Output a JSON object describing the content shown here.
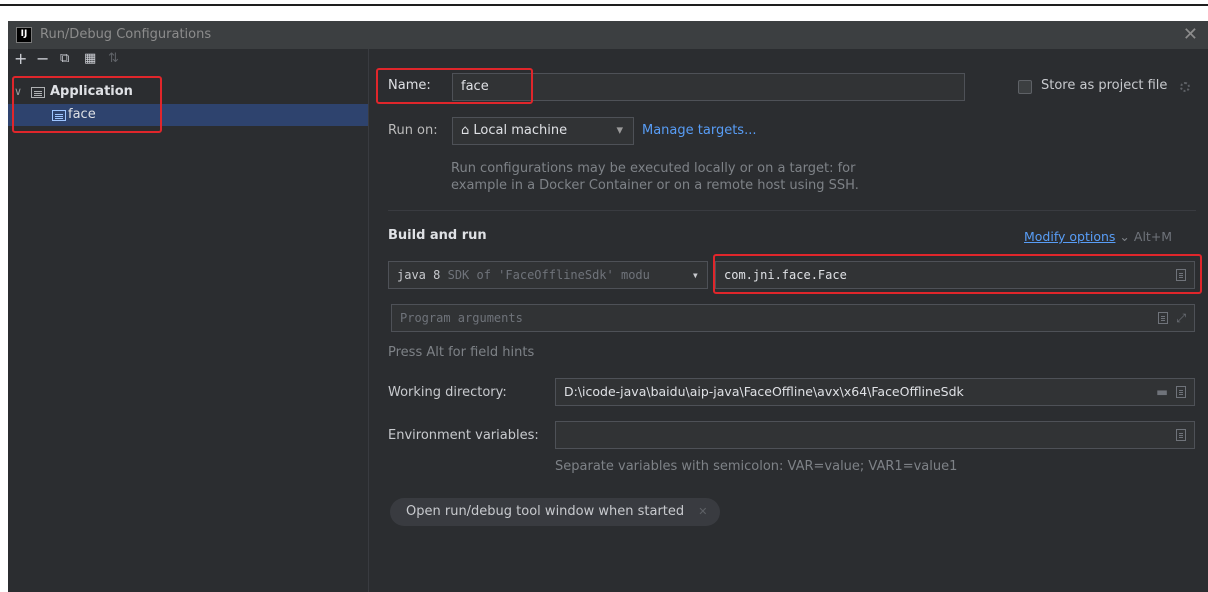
{
  "window": {
    "icon_text": "IJ",
    "title": "Run/Debug Configurations",
    "close_glyph": "✕"
  },
  "toolbar": {
    "add": "+",
    "remove": "−",
    "copy": "⧉",
    "folder": "▦",
    "sort": "⇅"
  },
  "tree": {
    "chevron": "∨",
    "group_label": "Application",
    "item_label": "face"
  },
  "form": {
    "name_label": "Name:",
    "name_value": "face",
    "store_label": "Store as project file",
    "run_on_label": "Run on:",
    "run_on_value": "Local machine",
    "run_on_icon": "⌂",
    "dropdown_arrow": "▾",
    "manage_targets": "Manage targets...",
    "run_on_hint_line1": "Run configurations may be executed locally or on a target: for",
    "run_on_hint_line2": "example in a Docker Container or on a remote host using SSH.",
    "section_title": "Build and run",
    "modify_options": "Modify options",
    "modify_chevron": "⌄",
    "modify_shortcut": "Alt+M",
    "sdk_strong": "java 8",
    "sdk_detail": "SDK of 'FaceOfflineSdk' modu",
    "main_class": "com.jni.face.Face",
    "program_args_placeholder": "Program arguments",
    "expand_glyph": "⤢",
    "field_hints": "Press Alt for field hints",
    "working_dir_label": "Working directory:",
    "working_dir_value": "D:\\icode-java\\baidu\\aip-java\\FaceOffline\\avx\\x64\\FaceOfflineSdk",
    "folder_glyph": "▬",
    "env_label": "Environment variables:",
    "env_hint": "Separate variables with semicolon: VAR=value; VAR1=value1",
    "open_tool_window": "Open run/debug tool window when started",
    "pill_close": "✕"
  }
}
